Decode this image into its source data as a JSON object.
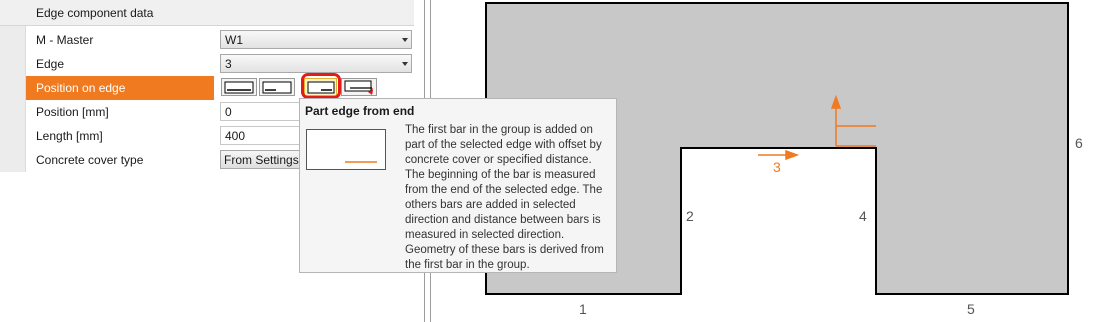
{
  "panel": {
    "group_title": "Edge component data",
    "rows": {
      "master": {
        "label": "M - Master",
        "value": "W1"
      },
      "edge": {
        "label": "Edge",
        "value": "3"
      },
      "position_on_edge": {
        "label": "Position on edge"
      },
      "position": {
        "label": "Position [mm]",
        "value": "0"
      },
      "length": {
        "label": "Length [mm]",
        "value": "400"
      },
      "cover": {
        "label": "Concrete cover type",
        "value": "From Settings"
      }
    },
    "position_options": [
      "whole-edge-icon",
      "part-edge-from-start-icon",
      "part-edge-from-end-icon",
      "part-edge-bent-icon"
    ],
    "selected_option": "part-edge-from-end-icon"
  },
  "tooltip": {
    "title": "Part edge from end",
    "lines": [
      "The first bar in the group is added on",
      "part of the selected edge with offset by",
      "concrete cover or specified distance.",
      "The beginning of the bar is measured",
      "from the end of the selected edge. The",
      "others bars are added in selected",
      "direction and distance between bars is",
      "measured in selected direction.",
      "Geometry of these bars is derived from",
      "the first bar in the group."
    ]
  },
  "drawing": {
    "edge_labels": {
      "e1": "1",
      "e2": "2",
      "e3": "3",
      "e4": "4",
      "e5": "5",
      "e6": "6"
    },
    "selected_edge": "3",
    "colors": {
      "fill": "#c8c8c8",
      "outline": "#000000",
      "accent": "#f07a1f"
    }
  }
}
